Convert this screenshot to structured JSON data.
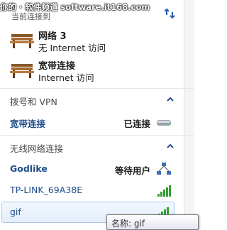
{
  "watermark": "你的 · 软件频道 software.it168.com",
  "overlap_label": "当前连接到",
  "current": [
    {
      "title": "网络  3",
      "subtitle": "无 Internet 访问"
    },
    {
      "title": "宽带连接",
      "subtitle": "Internet 访问"
    }
  ],
  "groups": {
    "dialup": {
      "label": "拨号和 VPN",
      "items": [
        {
          "name": "宽带连接",
          "status": "已连接",
          "icon": "modem-icon"
        }
      ]
    },
    "wireless": {
      "label": "无线网络连接",
      "items": [
        {
          "name": "Godlike",
          "status": "等待用户",
          "icon": "adhoc-network-icon"
        },
        {
          "name": "TP-LINK_69A38E",
          "status": "",
          "icon": "wifi-signal-icon"
        },
        {
          "name": "gif",
          "status": "",
          "icon": "wifi-signal-icon"
        }
      ]
    }
  },
  "tooltip": "名称: gif",
  "colors": {
    "link": "#1f4e8a",
    "divider": "#dfe6ee",
    "signal": "#2fa12f"
  }
}
